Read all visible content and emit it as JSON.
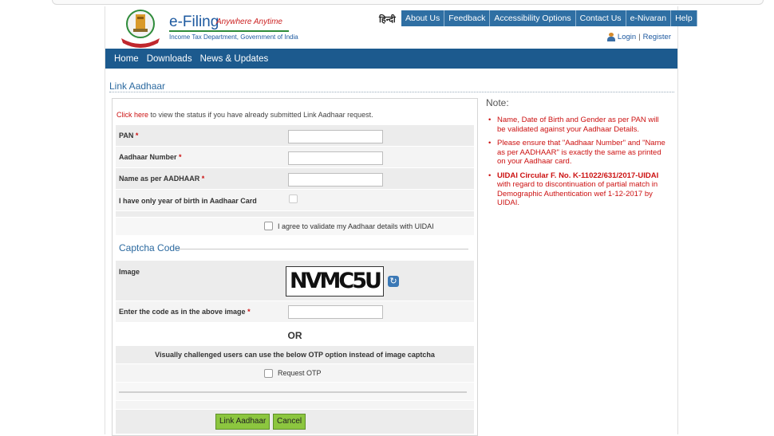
{
  "header": {
    "brand_title": "e-Filing",
    "brand_tagline": "Anywhere Anytime",
    "brand_subtitle": "Income Tax Department, Government of India",
    "hindi_link": "हिन्दी",
    "top_nav": [
      "About Us",
      "Feedback",
      "Accessibility Options",
      "Contact Us",
      "e-Nivaran",
      "Help"
    ],
    "login": "Login",
    "separator": "|",
    "register": "Register"
  },
  "main_nav": [
    "Home",
    "Downloads",
    "News & Updates"
  ],
  "page": {
    "title": "Link Aadhaar"
  },
  "form": {
    "click_here": "Click here",
    "click_here_rest": " to view the status if you have already submitted Link Aadhaar request.",
    "pan_label": "PAN",
    "aadhaar_label": "Aadhaar Number",
    "name_label": "Name as per AADHAAR",
    "year_label": "I have only year of birth in Aadhaar Card",
    "required_mark": "*",
    "agree_label": "I agree to validate my Aadhaar details with UIDAI",
    "captcha_heading": "Captcha Code",
    "image_label": "Image",
    "captcha_text": "NVMC5U",
    "code_label": "Enter the code as in the above image",
    "or_text": "OR",
    "visually_challenged": "Visually challenged users can use the below OTP option instead of image captcha",
    "request_otp": "Request OTP",
    "link_button": "Link Aadhaar",
    "cancel_button": "Cancel"
  },
  "note": {
    "heading": "Note:",
    "items": [
      "Name, Date of Birth and Gender as per PAN will be validated against your Aadhaar Details.",
      "Please ensure that \"Aadhaar Number\" and \"Name as per AADHAAR\" is exactly the same as printed on your Aadhaar card."
    ],
    "circular_bold": "UIDAI Circular F. No. K-11022/631/2017-UIDAI",
    "circular_rest": " with regard to discontinuation of partial match in Demographic Authentication wef 1-12-2017 by UIDAI."
  },
  "colors": {
    "nav_blue": "#1c5a8e",
    "topnav_blue": "#2f6fa3",
    "button_green": "#8cc63f",
    "note_red": "#cc1111"
  }
}
